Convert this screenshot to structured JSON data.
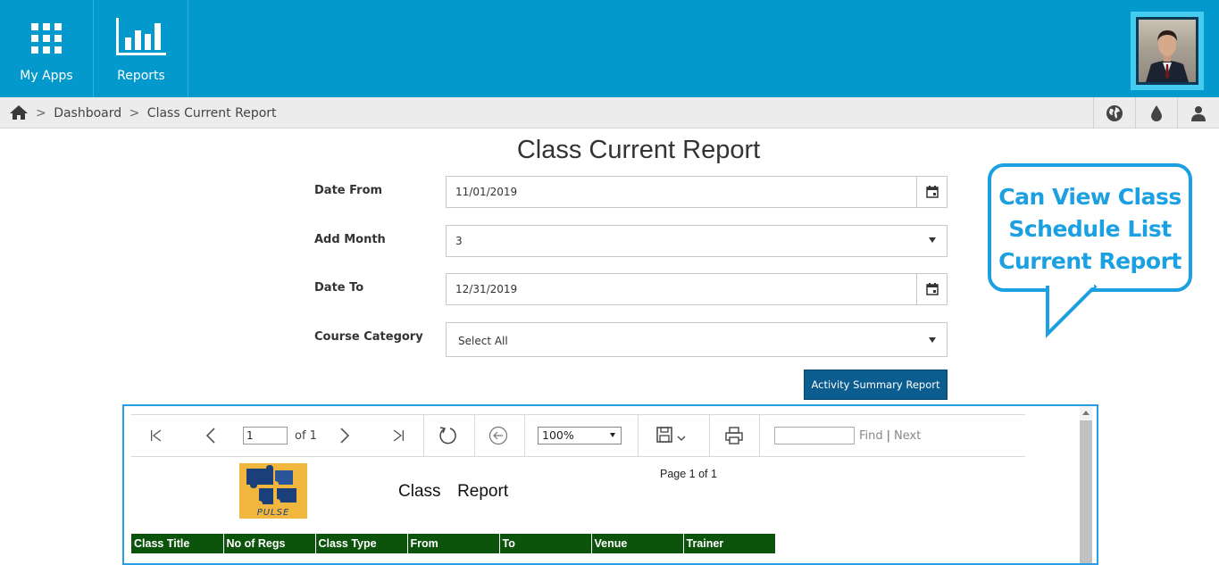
{
  "topnav": {
    "items": [
      {
        "label": "My Apps",
        "icon": "grid-icon"
      },
      {
        "label": "Reports",
        "icon": "bar-chart-icon"
      }
    ]
  },
  "breadcrumb": {
    "items": [
      "Dashboard",
      "Class Current Report"
    ],
    "separator": ">"
  },
  "page": {
    "title": "Class Current Report"
  },
  "form": {
    "date_from": {
      "label": "Date From",
      "value": "11/01/2019"
    },
    "add_month": {
      "label": "Add Month",
      "value": "3"
    },
    "date_to": {
      "label": "Date To",
      "value": "12/31/2019"
    },
    "course_category": {
      "label": "Course Category",
      "value": "Select All"
    },
    "summary_button": "Activity Summary Report"
  },
  "callout": {
    "lines": [
      "Can View Class",
      "Schedule List",
      "Current Report"
    ],
    "color": "#1ba0e1"
  },
  "viewer": {
    "page_input": "1",
    "page_of": "of 1",
    "zoom": "100%",
    "find_label": "Find",
    "next_label": "Next",
    "page_count": "Page 1 of 1",
    "report_title": "Class  Report",
    "logo_text": "PULSE",
    "columns": [
      "Class Title",
      "No of Regs",
      "Class Type",
      "From",
      "To",
      "Venue",
      "Trainer"
    ]
  },
  "colors": {
    "header_bg": "#0399cc",
    "button_bg": "#0b5d8f",
    "table_header_bg": "#0c530c"
  }
}
